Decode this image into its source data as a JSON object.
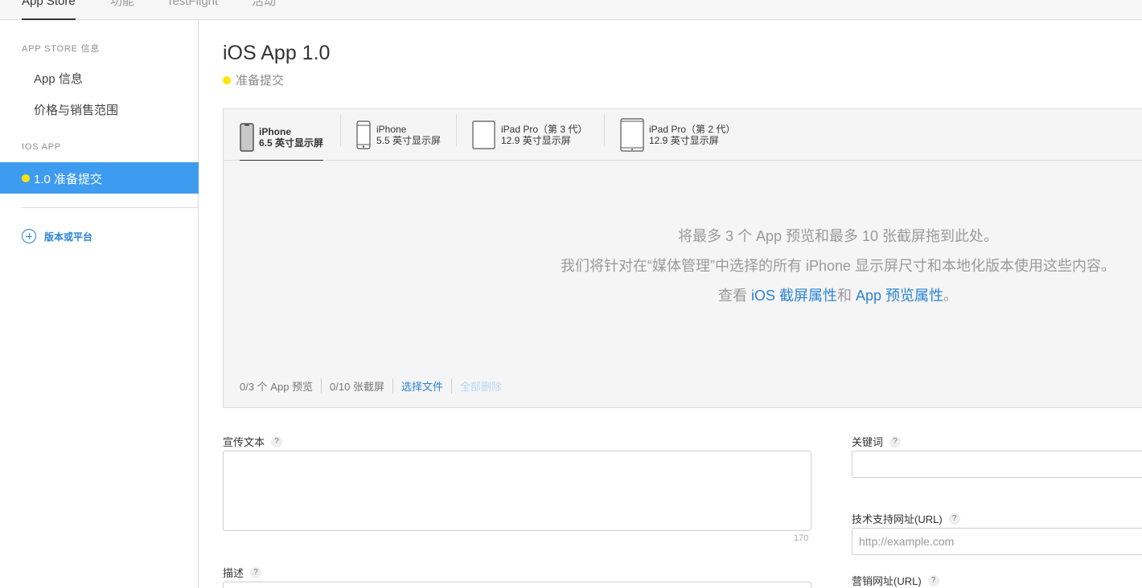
{
  "top_tabs": [
    {
      "label": "App Store",
      "active": true
    },
    {
      "label": "功能",
      "active": false
    },
    {
      "label": "TestFlight",
      "active": false
    },
    {
      "label": "活动",
      "active": false
    }
  ],
  "sidebar": {
    "section1": "APP STORE 信息",
    "items": [
      "App 信息",
      "价格与销售范围"
    ],
    "section2": "IOS APP",
    "active_version": "1.0 准备提交",
    "add_version": "版本或平台"
  },
  "version": {
    "title": "iOS App 1.0",
    "status": "准备提交",
    "status_color": "#ffe400"
  },
  "media": {
    "devices": [
      {
        "name": "iPhone",
        "size": "6.5 英寸显示屏",
        "icon": "iphone-x-icon",
        "active": true
      },
      {
        "name": "iPhone",
        "size": "5.5 英寸显示屏",
        "icon": "iphone-icon",
        "active": false
      },
      {
        "name": "iPad Pro（第 3 代）",
        "size": "12.9 英寸显示屏",
        "icon": "ipad-pro-3-icon",
        "active": false
      },
      {
        "name": "iPad Pro（第 2 代）",
        "size": "12.9 英寸显示屏",
        "icon": "ipad-pro-2-icon",
        "active": false
      }
    ],
    "drop_line1": "将最多 3 个 App 预览和最多 10 张截屏拖到此处。",
    "drop_line2": "我们将针对在“媒体管理”中选择的所有 iPhone 显示屏尺寸和本地化版本使用这些内容。",
    "drop_line3_prefix": "查看 ",
    "link_screenshot": "iOS 截屏属性",
    "drop_line3_mid": "和 ",
    "link_preview": "App 预览属性",
    "drop_line3_suffix": "。",
    "previews_count": "0/3 个 App 预览",
    "screenshots_count": "0/10 张截屏",
    "choose_file": "选择文件",
    "delete_all": "全部删除"
  },
  "form": {
    "promo_label": "宣传文本",
    "promo_counter": "170",
    "description_label": "描述",
    "keywords_label": "关键词",
    "support_url_label": "技术支持网址(URL)",
    "support_url_placeholder": "http://example.com",
    "marketing_url_label": "营销网址(URL)",
    "help_glyph": "?"
  },
  "colors": {
    "accent": "#2b83d6",
    "sidebar_active": "#3d9bf0"
  }
}
